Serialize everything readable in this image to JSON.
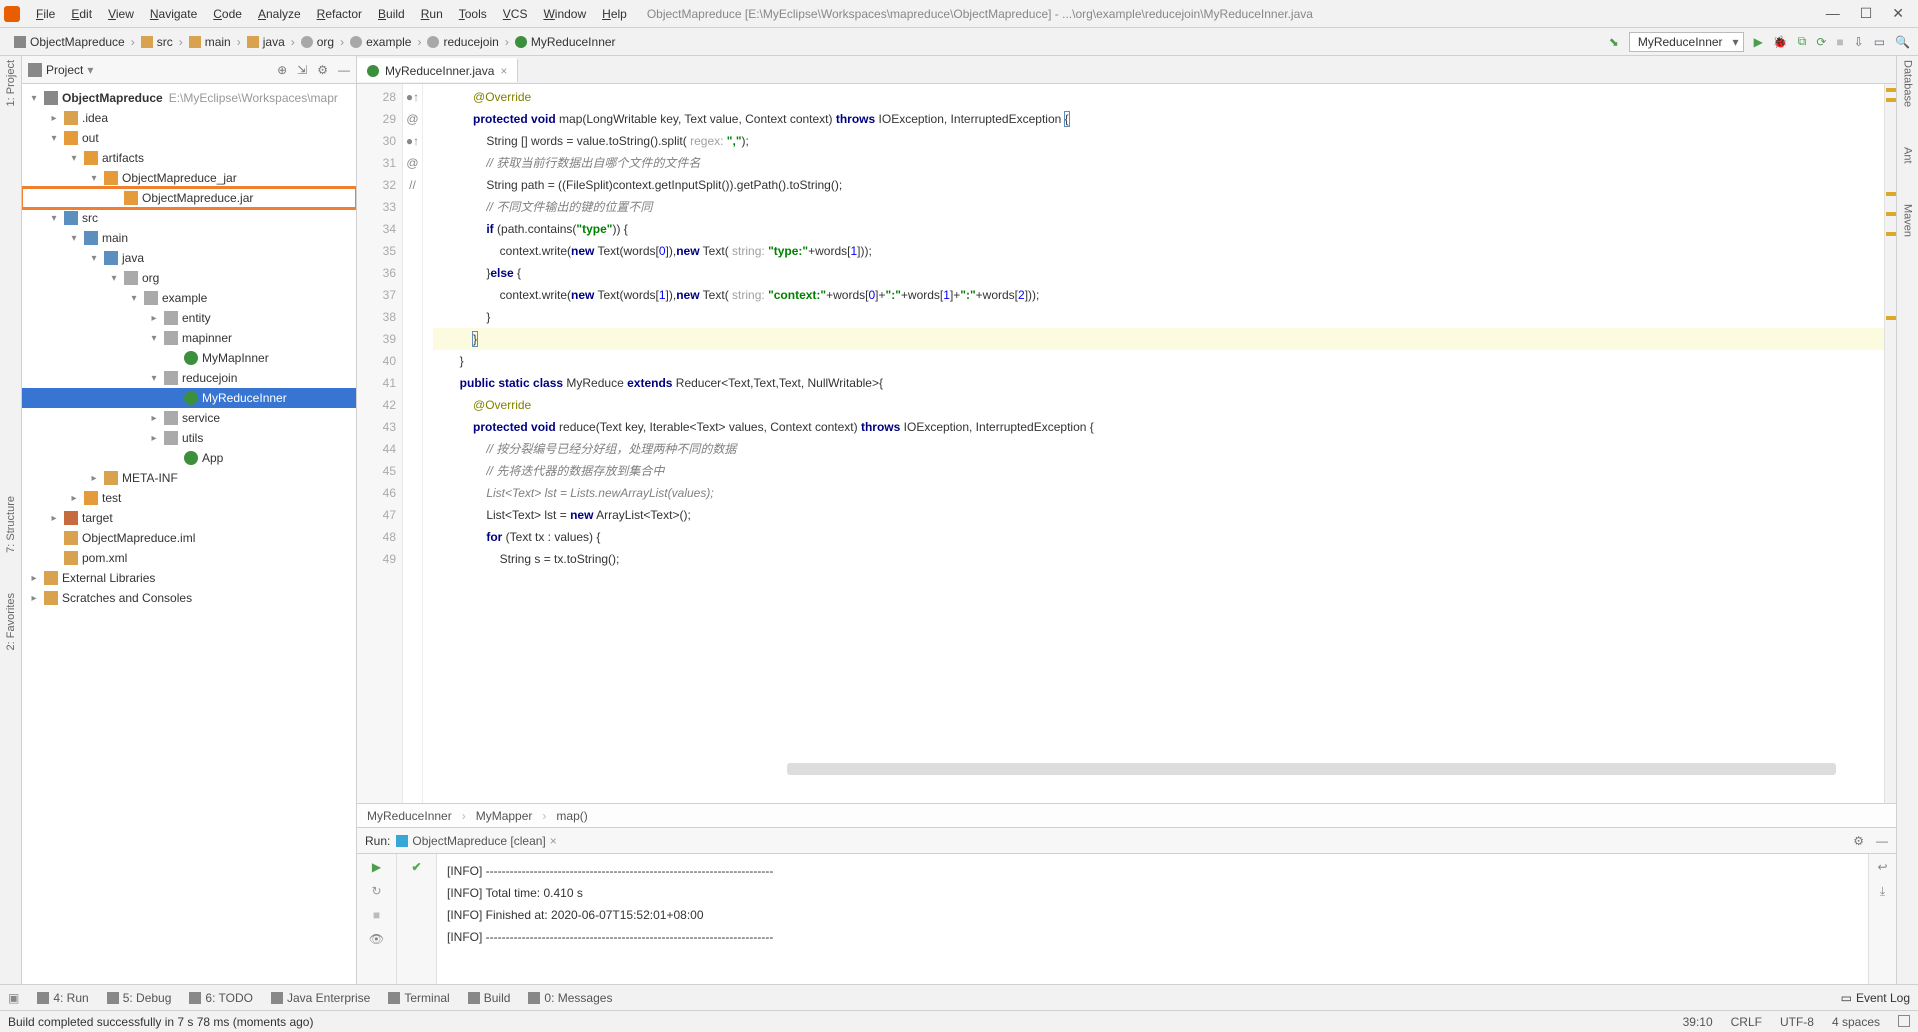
{
  "menu": {
    "items": [
      "File",
      "Edit",
      "View",
      "Navigate",
      "Code",
      "Analyze",
      "Refactor",
      "Build",
      "Run",
      "Tools",
      "VCS",
      "Window",
      "Help"
    ]
  },
  "window": {
    "title": "ObjectMapreduce [E:\\MyEclipse\\Workspaces\\mapreduce\\ObjectMapreduce] - ...\\org\\example\\reducejoin\\MyReduceInner.java"
  },
  "breadcrumb": {
    "items": [
      "ObjectMapreduce",
      "src",
      "main",
      "java",
      "org",
      "example",
      "reducejoin",
      "MyReduceInner"
    ]
  },
  "runconfig": {
    "selected": "MyReduceInner"
  },
  "project": {
    "title": "Project",
    "root": {
      "name": "ObjectMapreduce",
      "path": "E:\\MyEclipse\\Workspaces\\mapr"
    },
    "tree": [
      {
        "indent": 1,
        "arrow": "▸",
        "icon": "folder",
        "label": ".idea"
      },
      {
        "indent": 1,
        "arrow": "▾",
        "icon": "folder-orange",
        "label": "out"
      },
      {
        "indent": 2,
        "arrow": "▾",
        "icon": "folder-orange",
        "label": "artifacts"
      },
      {
        "indent": 3,
        "arrow": "▾",
        "icon": "folder-orange",
        "label": "ObjectMapreduce_jar"
      },
      {
        "indent": 4,
        "arrow": "",
        "icon": "jar",
        "label": "ObjectMapreduce.jar",
        "highlight": true
      },
      {
        "indent": 1,
        "arrow": "▾",
        "icon": "folder-blue",
        "label": "src"
      },
      {
        "indent": 2,
        "arrow": "▾",
        "icon": "folder-blue",
        "label": "main"
      },
      {
        "indent": 3,
        "arrow": "▾",
        "icon": "folder-blue",
        "label": "java"
      },
      {
        "indent": 4,
        "arrow": "▾",
        "icon": "pkg",
        "label": "org"
      },
      {
        "indent": 5,
        "arrow": "▾",
        "icon": "pkg",
        "label": "example"
      },
      {
        "indent": 6,
        "arrow": "▸",
        "icon": "pkg",
        "label": "entity"
      },
      {
        "indent": 6,
        "arrow": "▾",
        "icon": "pkg",
        "label": "mapinner"
      },
      {
        "indent": 7,
        "arrow": "",
        "icon": "class",
        "label": "MyMapInner"
      },
      {
        "indent": 6,
        "arrow": "▾",
        "icon": "pkg",
        "label": "reducejoin"
      },
      {
        "indent": 7,
        "arrow": "",
        "icon": "class",
        "label": "MyReduceInner",
        "selected": true
      },
      {
        "indent": 6,
        "arrow": "▸",
        "icon": "pkg",
        "label": "service"
      },
      {
        "indent": 6,
        "arrow": "▸",
        "icon": "pkg",
        "label": "utils"
      },
      {
        "indent": 7,
        "arrow": "",
        "icon": "class",
        "label": "App"
      },
      {
        "indent": 3,
        "arrow": "▸",
        "icon": "folder",
        "label": "META-INF"
      },
      {
        "indent": 2,
        "arrow": "▸",
        "icon": "folder-orange",
        "label": "test"
      },
      {
        "indent": 1,
        "arrow": "▸",
        "icon": "folder-red",
        "label": "target"
      },
      {
        "indent": 1,
        "arrow": "",
        "icon": "file",
        "label": "ObjectMapreduce.iml"
      },
      {
        "indent": 1,
        "arrow": "",
        "icon": "m",
        "label": "pom.xml"
      },
      {
        "indent": 0,
        "arrow": "▸",
        "icon": "lib",
        "label": "External Libraries"
      },
      {
        "indent": 0,
        "arrow": "▸",
        "icon": "scratch",
        "label": "Scratches and Consoles"
      }
    ]
  },
  "editor": {
    "tab": "MyReduceInner.java",
    "first_line_no": 28,
    "lines": [
      {
        "n": 28,
        "html": "            <span class='ann'>@Override</span>"
      },
      {
        "n": 29,
        "gi": "●↑ @",
        "html": "            <span class='kw'>protected void</span> map(LongWritable key, Text value, Context context) <span class='kw'>throws</span> IOException, InterruptedException <span class='matchbr'>{</span>"
      },
      {
        "n": 30,
        "html": "                String [] words = value.toString().split( <span class='hint'>regex:</span> <span class='str'>\",\"</span>);"
      },
      {
        "n": 31,
        "html": "                <span class='cmt'>// 获取当前行数据出自哪个文件的文件名</span>"
      },
      {
        "n": 32,
        "html": "                String path = ((FileSplit)context.getInputSplit()).getPath().toString();"
      },
      {
        "n": 33,
        "html": "                <span class='cmt'>// 不同文件输出的键的位置不同</span>"
      },
      {
        "n": 34,
        "html": "                <span class='kw'>if</span> (path.contains(<span class='str'>\"type\"</span>)) {"
      },
      {
        "n": 35,
        "html": "                    context.write(<span class='kw'>new</span> Text(words[<span class='num'>0</span>]),<span class='kw'>new</span> Text( <span class='hint'>string:</span> <span class='str'>\"type:\"</span>+words[<span class='num'>1</span>]));"
      },
      {
        "n": 36,
        "html": "                }<span class='kw'>else</span> {"
      },
      {
        "n": 37,
        "html": "                    context.write(<span class='kw'>new</span> Text(words[<span class='num'>1</span>]),<span class='kw'>new</span> Text( <span class='hint'>string:</span> <span class='str'>\"context:\"</span>+words[<span class='num'>0</span>]+<span class='str'>\":\"</span>+words[<span class='num'>1</span>]+<span class='str'>\":\"</span>+words[<span class='num'>2</span>]));"
      },
      {
        "n": 38,
        "html": "                }"
      },
      {
        "n": 39,
        "caret": true,
        "html": "            <span class='matchbr'>}</span>"
      },
      {
        "n": 40,
        "html": "        }"
      },
      {
        "n": 41,
        "html": "        <span class='kw'>public static class</span> MyReduce <span class='kw'>extends</span> Reducer&lt;Text,Text,Text, NullWritable&gt;{"
      },
      {
        "n": 42,
        "html": "            <span class='ann'>@Override</span>"
      },
      {
        "n": 43,
        "gi": "●↑ @",
        "html": "            <span class='kw'>protected void</span> reduce(Text key, Iterable&lt;Text&gt; values, Context context) <span class='kw'>throws</span> IOException, InterruptedException {"
      },
      {
        "n": 44,
        "html": "                <span class='cmt'>// 按分裂编号已经分好组，处理两种不同的数据</span>"
      },
      {
        "n": 45,
        "html": "                <span class='cmt'>// 先将迭代器的数据存放到集合中</span>"
      },
      {
        "n": 46,
        "gi": "//",
        "html": "                <span class='cmt'>List&lt;Text&gt; lst = Lists.newArrayList(values);</span>"
      },
      {
        "n": 47,
        "html": "                List&lt;Text&gt; lst = <span class='kw'>new</span> ArrayList&lt;Text&gt;();"
      },
      {
        "n": 48,
        "html": "                <span class='kw'>for</span> (Text tx : values) {"
      },
      {
        "n": 49,
        "html": "                    String s = tx.toString();"
      }
    ],
    "crumbs": [
      "MyReduceInner",
      "MyMapper",
      "map()"
    ]
  },
  "run": {
    "title": "Run:",
    "config": "ObjectMapreduce [clean]",
    "output": [
      "[INFO] ------------------------------------------------------------------------",
      "[INFO] Total time: 0.410 s",
      "[INFO] Finished at: 2020-06-07T15:52:01+08:00",
      "[INFO] ------------------------------------------------------------------------"
    ]
  },
  "bottom": {
    "tools": [
      "4: Run",
      "5: Debug",
      "6: TODO",
      "Java Enterprise",
      "Terminal",
      "Build",
      "0: Messages"
    ],
    "event_log": "Event Log"
  },
  "status": {
    "msg": "Build completed successfully in 7 s 78 ms (moments ago)",
    "pos": "39:10",
    "eol": "CRLF",
    "enc": "UTF-8",
    "indent": "4 spaces"
  },
  "left_tabs": [
    "1: Project",
    "7: Structure",
    "2: Favorites"
  ],
  "right_tabs": [
    "Database",
    "Ant",
    "Maven"
  ]
}
